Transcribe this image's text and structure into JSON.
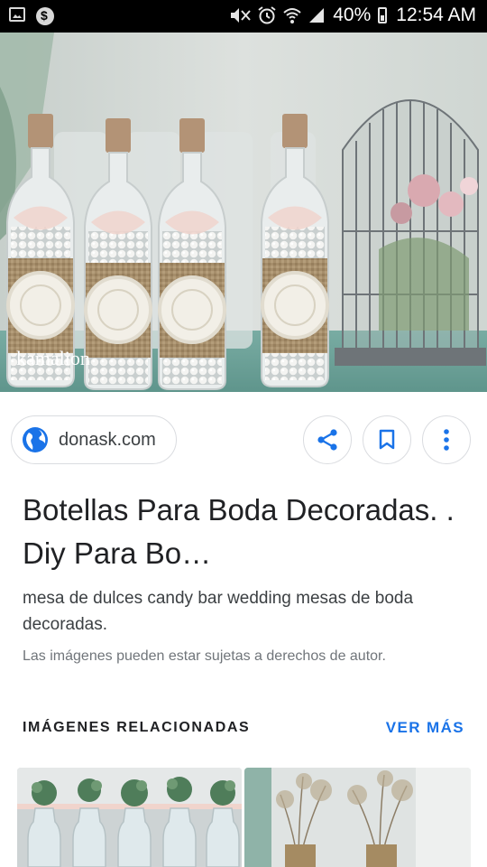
{
  "status_bar": {
    "icons_left": [
      "gallery-icon",
      "settings-app-icon"
    ],
    "icons_right": [
      "mute-icon",
      "alarm-icon",
      "wifi-icon",
      "signal-icon"
    ],
    "battery": "40%",
    "time": "12:54 AM"
  },
  "hero": {
    "watermark": "kamalion",
    "colors": {
      "bg": "#c9d0cc",
      "table": "#6fa59c"
    }
  },
  "source": {
    "domain": "donask.com",
    "icon": "globe-icon",
    "accent": "#1a73e8"
  },
  "actions": [
    {
      "name": "share",
      "icon": "share-icon"
    },
    {
      "name": "save",
      "icon": "bookmark-icon"
    },
    {
      "name": "more",
      "icon": "more-vert-icon"
    }
  ],
  "result": {
    "title": "Botellas Para Boda Decoradas. . Diy Para Bo…",
    "description": "mesa de dulces candy bar wedding mesas de boda decoradas.",
    "copyright": "Las imágenes pueden estar sujetas a derechos de autor."
  },
  "related": {
    "heading": "IMÁGENES RELACIONADAS",
    "see_more": "VER MÁS"
  }
}
